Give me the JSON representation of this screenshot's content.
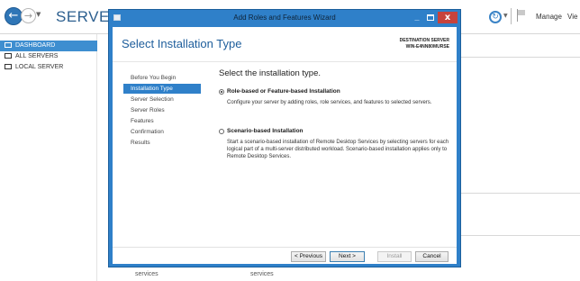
{
  "server_manager": {
    "title": "SERVER MA",
    "back_glyph": "←",
    "forward_glyph": "→",
    "dropdown_glyph": "▼",
    "refresh_glyph": "↻",
    "manage_label": "Manage",
    "view_label": "Vie",
    "sidebar": {
      "items": [
        {
          "label": "DASHBOARD",
          "icon": "dashboard-icon",
          "active": true
        },
        {
          "label": "ALL SERVERS",
          "icon": "servers-icon",
          "active": false
        },
        {
          "label": "LOCAL SERVER",
          "icon": "server-icon",
          "active": false
        }
      ]
    },
    "bottom_labels": [
      "services",
      "services"
    ]
  },
  "wizard": {
    "title": "Add Roles and Features Wizard",
    "heading": "Select Installation Type",
    "destination_label": "DESTINATION SERVER",
    "destination_server": "WIN-E4NN80MURSE",
    "steps": [
      {
        "label": "Before You Begin",
        "active": false
      },
      {
        "label": "Installation Type",
        "active": true
      },
      {
        "label": "Server Selection",
        "active": false
      },
      {
        "label": "Server Roles",
        "active": false
      },
      {
        "label": "Features",
        "active": false
      },
      {
        "label": "Confirmation",
        "active": false
      },
      {
        "label": "Results",
        "active": false
      }
    ],
    "content_heading": "Select the installation type.",
    "options": [
      {
        "label": "Role-based or Feature-based Installation",
        "description": "Configure your server by adding roles, role services, and features to selected servers.",
        "selected": true
      },
      {
        "label": "Scenario-based Installation",
        "description": "Start a scenario-based installation of Remote Desktop Services by selecting servers for each logical part of a multi-server distributed workload. Scenario-based installation applies only to Remote Desktop Services.",
        "selected": false
      }
    ],
    "buttons": {
      "previous": "< Previous",
      "next": "Next >",
      "install": "Install",
      "cancel": "Cancel"
    },
    "window_controls": {
      "minimize": "_",
      "close": "x"
    }
  },
  "colors": {
    "accent": "#2f80c9",
    "sidebar_active": "#3e8ed0",
    "heading": "#1d5d9b",
    "close": "#c7433c"
  }
}
